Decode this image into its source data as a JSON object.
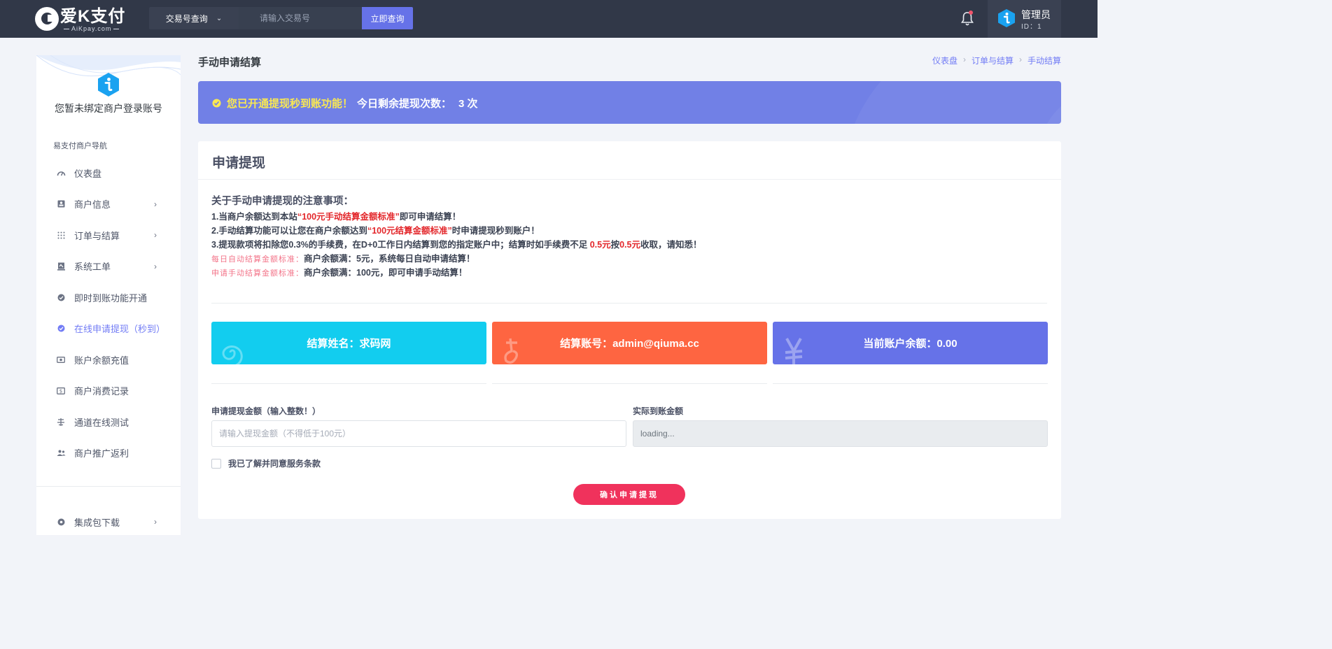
{
  "header": {
    "logo_name": "爱K支付",
    "logo_sub": "AiKpay.com",
    "search_type": "交易号查询",
    "search_placeholder": "请输入交易号",
    "search_button": "立即查询",
    "user_name": "管理员",
    "user_id": "ID：1"
  },
  "sidebar": {
    "account_text": "您暂未绑定商户登录账号",
    "nav_title": "易支付商户导航",
    "items": [
      {
        "label": "仪表盘",
        "icon": "dashboard-icon",
        "arrow": false
      },
      {
        "label": "商户信息",
        "icon": "merchant-card-icon",
        "arrow": true
      },
      {
        "label": "订单与结算",
        "icon": "grid-dots-icon",
        "arrow": true
      },
      {
        "label": "系统工单",
        "icon": "ticket-icon",
        "arrow": true
      },
      {
        "label": "即时到账功能开通",
        "icon": "check-badge-icon",
        "arrow": false
      },
      {
        "label": "在线申请提现（秒到）",
        "icon": "check-badge-icon",
        "arrow": false,
        "active": true
      },
      {
        "label": "账户余额充值",
        "icon": "cash-icon",
        "arrow": false
      },
      {
        "label": "商户消费记录",
        "icon": "receipt-icon",
        "arrow": false
      },
      {
        "label": "通道在线测试",
        "icon": "test-icon",
        "arrow": false
      },
      {
        "label": "商户推广返利",
        "icon": "users-icon",
        "arrow": false
      }
    ],
    "bottom_item": {
      "label": "集成包下载",
      "icon": "disc-icon",
      "arrow": true
    }
  },
  "page": {
    "title": "手动申请结算",
    "breadcrumb": [
      "仪表盘",
      "订单与结算",
      "手动结算"
    ]
  },
  "notice": {
    "highlight": "您已开通提现秒到账功能！",
    "rest": "今日剩余提现次数：",
    "count": "3 次"
  },
  "card": {
    "title": "申请提现",
    "rules_title": "关于手动申请提现的注意事项：",
    "rule1_a": "1.当商户余额达到本站",
    "rule1_b": "“100元手动结算金额标准”",
    "rule1_c": "即可申请结算！",
    "rule2_a": "2.手动结算功能可以让您在商户余额达到",
    "rule2_b": "“100元结算金额标准”",
    "rule2_c": "时申请提现秒到账户！",
    "rule3_a": "3.提现款项将扣除您0.3%的手续费，在D+0工作日内结算到您的指定账户中；结算时如手续费不足",
    "rule3_b": "0.5元",
    "rule3_c": "按",
    "rule3_d": "0.5元",
    "rule3_e": "收取，请知悉！",
    "auto_label": "每日自动结算金额标准：",
    "auto_text": "商户余额满：5元，系统每日自动申请结算！",
    "manual_label": "申请手动结算金额标准：",
    "manual_text": "商户余额满：100元，即可申请手动结算！",
    "stat_name": "结算姓名：求码网",
    "stat_account": "结算账号：admin@qiuma.cc",
    "stat_balance": "当前账户余额：0.00",
    "amount_label": "申请提现金额（输入整数！）",
    "amount_placeholder": "请输入提现金额（不得低于100元）",
    "actual_label": "实际到账金额",
    "actual_value": "loading...",
    "agree_text": "我已了解并同意服务条款",
    "submit_label": "确认申请提现"
  },
  "colors": {
    "topbar": "#313848",
    "accent": "#727cf5",
    "cyan": "#12cdef",
    "orange": "#fe6541",
    "purple": "#6672e8",
    "danger": "#f0325c"
  }
}
